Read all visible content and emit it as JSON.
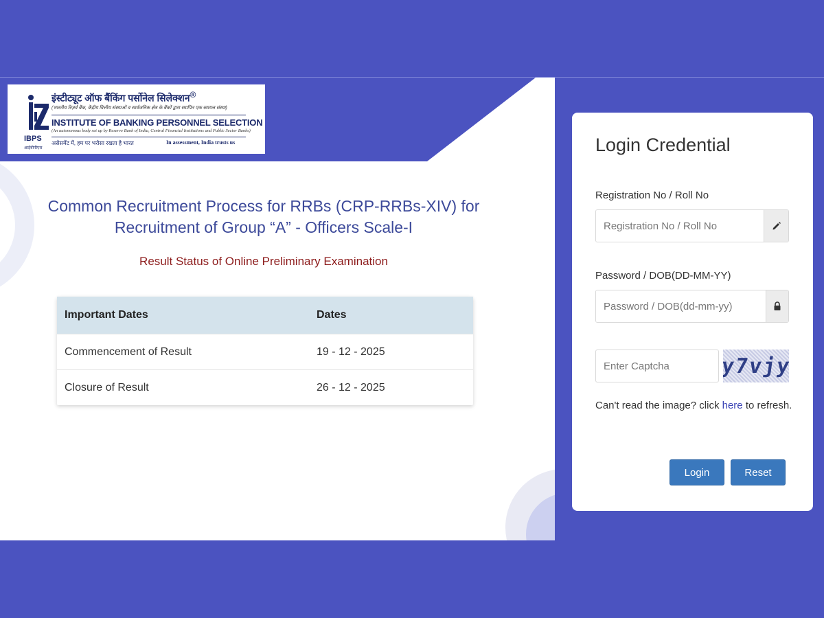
{
  "logo": {
    "hindi_title": "इंस्टीट्यूट ऑफ बैंकिंग पर्सोनेल सिलेक्शन",
    "registered_mark": "®",
    "hindi_subtitle": "(भारतीय रिज़र्व बैंक, केंद्रीय वित्तीय संस्थाओं व सार्वजनिक क्षेत्र के बैंकों द्वारा स्थापित एक स्वायत्त संस्था)",
    "english_title": "INSTITUTE OF BANKING PERSONNEL SELECTION",
    "english_subtitle": "(An autonomous body set up by Reserve Bank of India, Central Financial Institutions and Public Sector Banks)",
    "mark_text": "IBPS",
    "mark_hindi": "आईबीपीएस",
    "tagline_hindi": "असेसमेंट में, हम पर भरोसा रखता है भारत",
    "tagline_english": "In assessment, India trusts us"
  },
  "main": {
    "headline_line1": "Common Recruitment Process for RRBs (CRP-RRBs-XIV) for",
    "headline_line2": "Recruitment of Group “A” - Officers Scale-I",
    "subheading": "Result Status of Online Preliminary Examination",
    "table": {
      "headers": [
        "Important Dates",
        "Dates"
      ],
      "rows": [
        [
          "Commencement of Result",
          "19 - 12 - 2025"
        ],
        [
          "Closure of Result",
          "26 - 12 - 2025"
        ]
      ]
    }
  },
  "login": {
    "title": "Login Credential",
    "registration_label": "Registration No / Roll No",
    "registration_placeholder": "Registration No / Roll No",
    "registration_icon": "pencil-icon",
    "password_label": "Password / DOB(DD-MM-YY)",
    "password_placeholder": "Password / DOB(dd-mm-yy)",
    "password_icon": "lock-icon",
    "captcha_placeholder": "Enter Captcha",
    "captcha_text": "y7vjy",
    "refresh_prefix": "Can't read the image? click ",
    "refresh_link": "here",
    "refresh_suffix": " to refresh.",
    "login_button": "Login",
    "reset_button": "Reset"
  },
  "colors": {
    "background": "#4b53c0",
    "headline": "#3d4a9a",
    "subheading": "#8d1c1c",
    "table_header": "#d4e3ec",
    "button": "#3a78bd"
  }
}
